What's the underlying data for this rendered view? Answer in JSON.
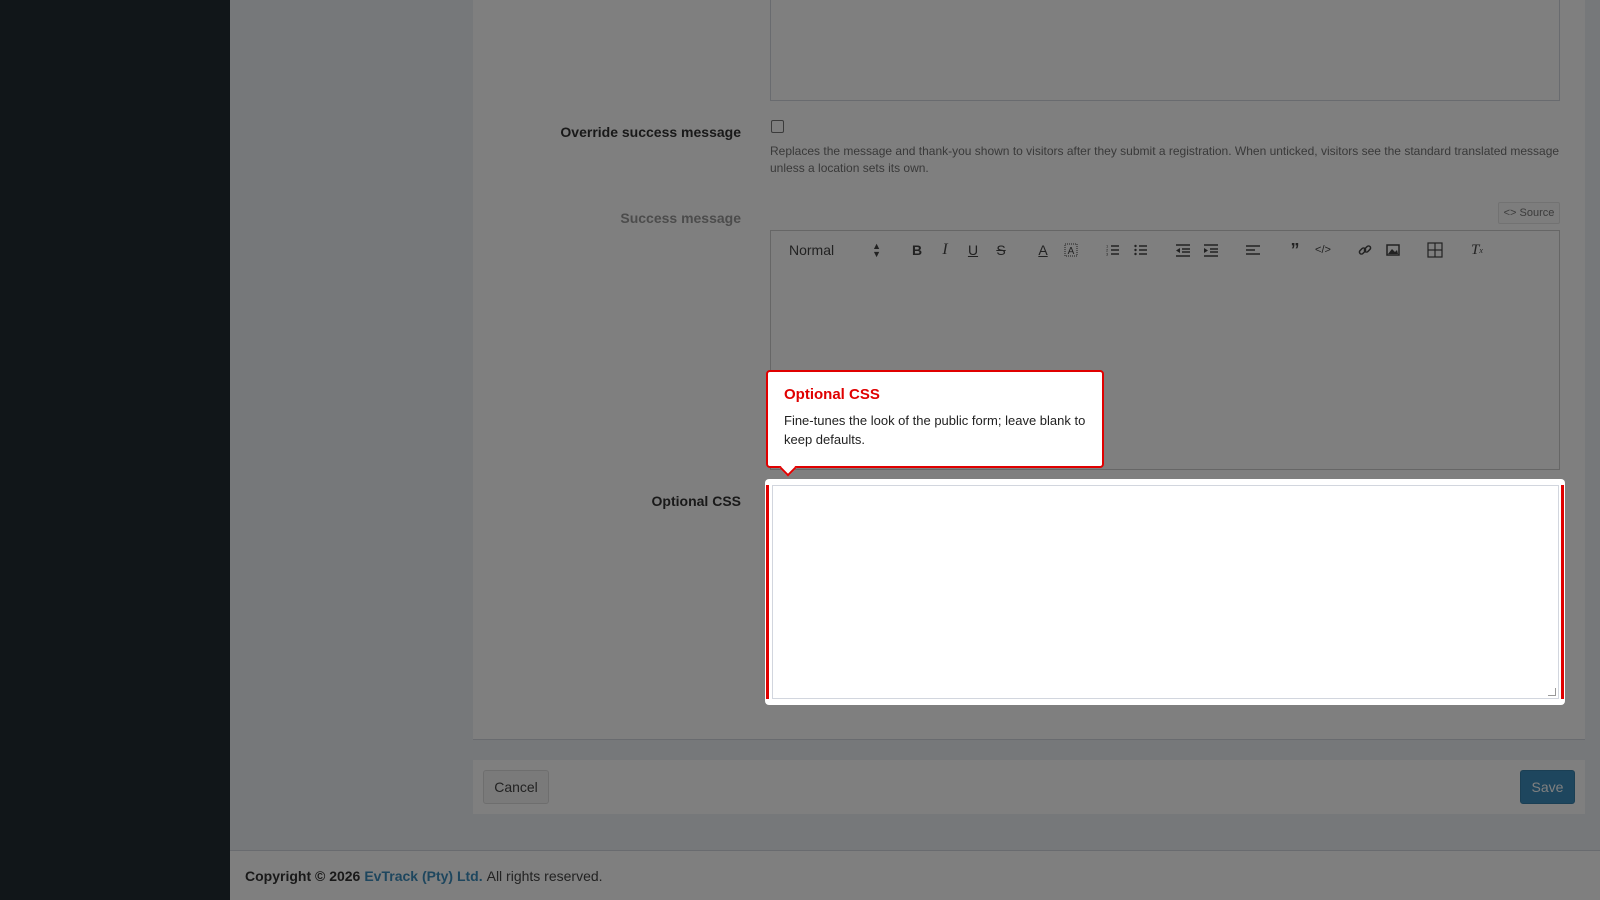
{
  "form": {
    "override_label": "Override success message",
    "override_help": "Replaces the message and thank-you shown to visitors after they submit a registration. When unticked, visitors see the standard translated message unless a location sets its own.",
    "success_label": "Success message",
    "source_button": "<> Source",
    "editor": {
      "format_select": "Normal",
      "tools": [
        "bold-icon",
        "italic-icon",
        "underline-icon",
        "strike-icon",
        "text-color-icon",
        "background-color-icon",
        "ordered-list-icon",
        "bullet-list-icon",
        "outdent-icon",
        "indent-icon",
        "align-icon",
        "blockquote-icon",
        "code-icon",
        "link-icon",
        "image-icon",
        "table-icon",
        "clear-format-icon"
      ]
    },
    "css_label": "Optional CSS"
  },
  "tooltip": {
    "title": "Optional CSS",
    "text": "Fine-tunes the look of the public form; leave blank to keep defaults."
  },
  "actions": {
    "cancel": "Cancel",
    "save": "Save"
  },
  "footer": {
    "copyright": "Copyright © 2026",
    "company": "EvTrack (Pty) Ltd.",
    "rights": "All rights reserved."
  },
  "colors": {
    "accent": "#3c8dbc",
    "highlight": "#e00000"
  }
}
